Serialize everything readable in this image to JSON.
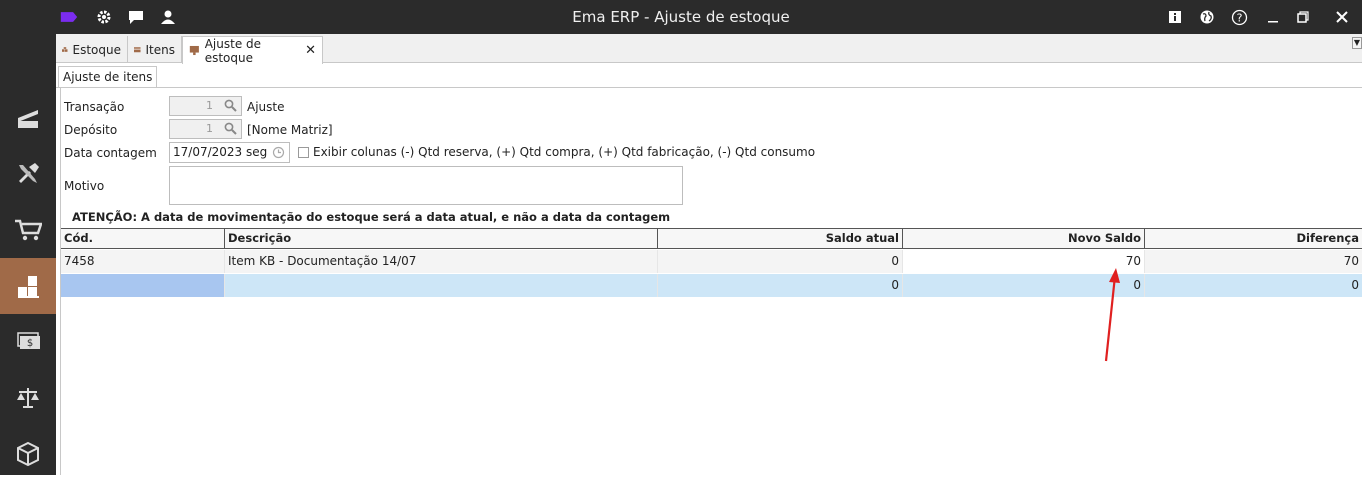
{
  "window": {
    "title": "Ema ERP - Ajuste de estoque"
  },
  "colors": {
    "titlebar": "#2b2b2b",
    "accent": "#a06a48",
    "selection": "#cde6f7",
    "selection_code": "#a8c6f0",
    "annotation_arrow": "#e02020",
    "logo": "#7b2cf0"
  },
  "tabs": [
    {
      "label": "Estoque",
      "icon": "warehouse-icon"
    },
    {
      "label": "Itens",
      "icon": "box-icon"
    },
    {
      "label": "Ajuste de estoque",
      "icon": "adjust-icon"
    }
  ],
  "subtab": {
    "label": "Ajuste de itens"
  },
  "form": {
    "transacao": {
      "label": "Transação",
      "value": "1",
      "text": "Ajuste"
    },
    "deposito": {
      "label": "Depósito",
      "value": "1",
      "text": "[Nome Matriz]"
    },
    "data_contagem": {
      "label": "Data contagem",
      "value": "17/07/2023 seg"
    },
    "exibir": {
      "label": "Exibir colunas (-) Qtd reserva, (+) Qtd compra, (+) Qtd fabricação, (-) Qtd consumo",
      "checked": false
    },
    "motivo": {
      "label": "Motivo",
      "value": ""
    }
  },
  "warning": "ATENÇÃO: A data de movimentação do estoque será a data atual, e não a data da contagem",
  "table": {
    "headers": {
      "cod": "Cód.",
      "descricao": "Descrição",
      "saldo_atual": "Saldo atual",
      "novo_saldo": "Novo Saldo",
      "diferenca": "Diferença"
    },
    "rows": [
      {
        "cod": "7458",
        "descricao": "Item KB - Documentação 14/07",
        "saldo_atual": "0",
        "novo_saldo": "70",
        "diferenca": "70"
      },
      {
        "cod": "",
        "descricao": "",
        "saldo_atual": "0",
        "novo_saldo": "0",
        "diferenca": "0"
      }
    ]
  },
  "sidebar": {
    "items": [
      "dashboard-icon",
      "tools-icon",
      "cart-icon",
      "stock-icon",
      "money-icon",
      "scale-icon",
      "package-icon"
    ]
  }
}
